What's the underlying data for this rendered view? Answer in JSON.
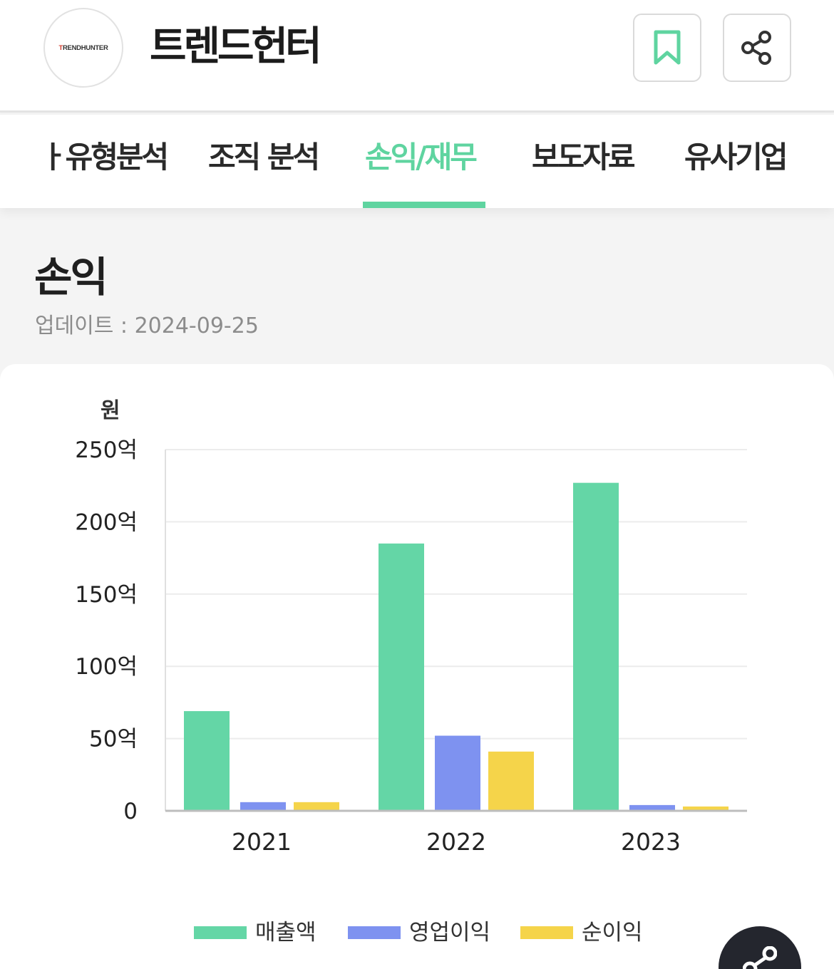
{
  "header": {
    "logo_text_pre": "T",
    "logo_text_accent": "RENDHUNTER",
    "company_name": "트렌드헌터",
    "bookmark_icon": "bookmark-icon",
    "share_icon": "share-icon"
  },
  "tabs": [
    {
      "label": "ㅏ유형분석"
    },
    {
      "label": "조직 분석"
    },
    {
      "label": "손익/재무",
      "active": true
    },
    {
      "label": "보도자료"
    },
    {
      "label": "유사기업"
    }
  ],
  "section": {
    "title": "손익",
    "updated": "업데이트 : 2024-09-25"
  },
  "colors": {
    "accent": "#5fd4a0",
    "revenue": "#64d6a6",
    "operating": "#7e92f0",
    "net": "#f5d44a"
  },
  "chart_data": {
    "type": "bar",
    "unit_label": "원",
    "categories": [
      "2021",
      "2022",
      "2023"
    ],
    "series": [
      {
        "name": "매출액",
        "values": [
          69,
          185,
          227
        ]
      },
      {
        "name": "영업이익",
        "values": [
          6,
          52,
          4
        ]
      },
      {
        "name": "순이익",
        "values": [
          6,
          41,
          3
        ]
      }
    ],
    "ylim": [
      0,
      250
    ],
    "yticks": [
      0,
      50,
      100,
      150,
      200,
      250
    ],
    "ytick_labels": [
      "0",
      "50억",
      "100억",
      "150억",
      "200억",
      "250억"
    ],
    "grid": true,
    "legend_position": "bottom"
  },
  "fab_icon": "share-icon"
}
